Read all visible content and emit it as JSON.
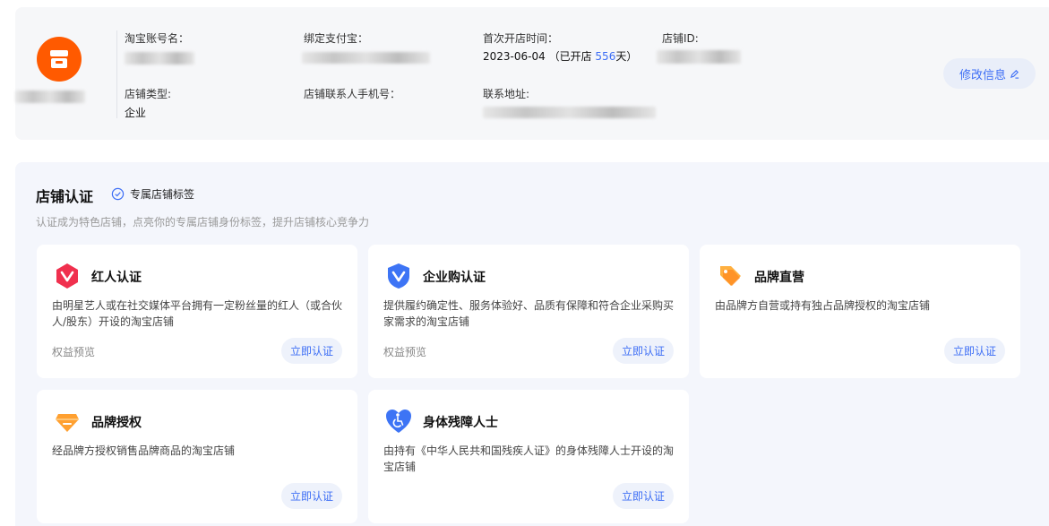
{
  "header": {
    "fields": {
      "account_label": "淘宝账号名：",
      "alipay_label": "绑定支付宝：",
      "open_time_label": "首次开店时间：",
      "open_date": "2023-06-04",
      "open_prefix": "（已开店",
      "open_days": "556",
      "open_suffix": "天）",
      "shop_id_label": "店铺ID:",
      "shop_type_label": "店铺类型:",
      "shop_type_value": "企业",
      "contact_phone_label": "店铺联系人手机号：",
      "address_label": "联系地址:"
    },
    "edit_button": "修改信息"
  },
  "certification": {
    "title": "店铺认证",
    "tag_label": "专属店铺标签",
    "subtitle": "认证成为特色店铺，点亮你的专属店铺身份标签，提升店铺核心竞争力",
    "cards": [
      {
        "title": "红人认证",
        "desc": "由明星艺人或在社交媒体平台拥有一定粉丝量的红人（或合伙人/股东）开设的淘宝店铺",
        "link": "权益预览",
        "button": "立即认证",
        "icon": "influencer-v-icon",
        "color": "#f0304e"
      },
      {
        "title": "企业购认证",
        "desc": "提供履约确定性、服务体验好、品质有保障和符合企业采购买家需求的淘宝店铺",
        "link": "权益预览",
        "button": "立即认证",
        "icon": "enterprise-shield-icon",
        "color": "#3d74f5"
      },
      {
        "title": "品牌直营",
        "desc": "由品牌方自营或持有独占品牌授权的淘宝店铺",
        "button": "立即认证",
        "icon": "brand-tag-icon",
        "color": "#ffa030"
      },
      {
        "title": "品牌授权",
        "desc": "经品牌方授权销售品牌商品的淘宝店铺",
        "button": "立即认证",
        "icon": "brand-gem-icon",
        "color": "#ffa030"
      },
      {
        "title": "身体残障人士",
        "desc": "由持有《中华人民共和国残疾人证》的身体残障人士开设的淘宝店铺",
        "button": "立即认证",
        "icon": "accessibility-heart-icon",
        "color": "#3d74f5"
      }
    ]
  },
  "colors": {
    "accent": "#3d6ef5",
    "logo": "#ff5a00"
  }
}
